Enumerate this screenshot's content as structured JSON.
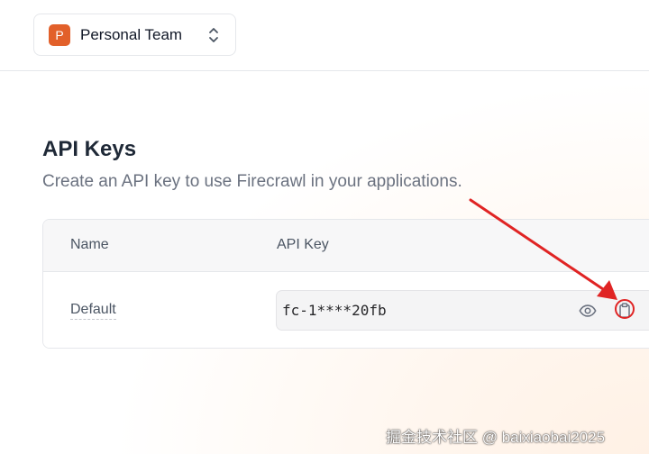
{
  "team_switcher": {
    "avatar_letter": "P",
    "name": "Personal Team",
    "icons": {
      "chevrons": "chevron-up-down-icon"
    }
  },
  "page": {
    "title": "API Keys",
    "subtitle": "Create an API key to use Firecrawl in your applications."
  },
  "api_keys_table": {
    "columns": [
      "Name",
      "API Key"
    ],
    "rows": [
      {
        "name": "Default",
        "api_key": "fc-1****20fb"
      }
    ],
    "row_actions": {
      "reveal_icon": "eye-icon",
      "copy_icon": "clipboard-icon"
    }
  },
  "annotation": {
    "arrow_color": "#e02424",
    "highlight_target": "copy-button"
  },
  "watermark": {
    "text": "掘金技术社区 @ baixiaobai2025"
  },
  "colors": {
    "accent": "#e2602a",
    "annotation_red": "#e02424",
    "border": "#e5e7eb",
    "header_bg": "#f7f7f8",
    "input_bg": "#f4f4f5"
  }
}
